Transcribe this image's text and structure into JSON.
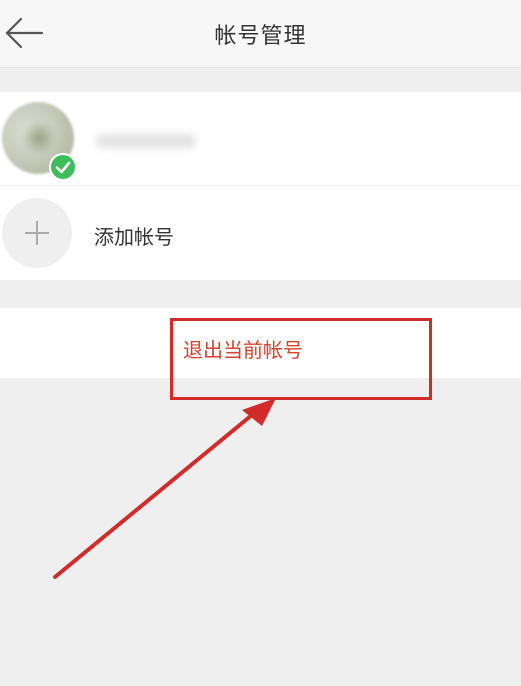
{
  "header": {
    "title": "帐号管理",
    "back_icon": "arrow-left-icon"
  },
  "accounts": {
    "current": {
      "status_icon": "check-icon",
      "status_color": "#3dbd5b"
    },
    "add_account": {
      "label": "添加帐号",
      "icon": "plus-icon"
    }
  },
  "logout": {
    "label": "退出当前帐号",
    "color": "#d8412f"
  },
  "annotation": {
    "color": "#d32a2a"
  }
}
